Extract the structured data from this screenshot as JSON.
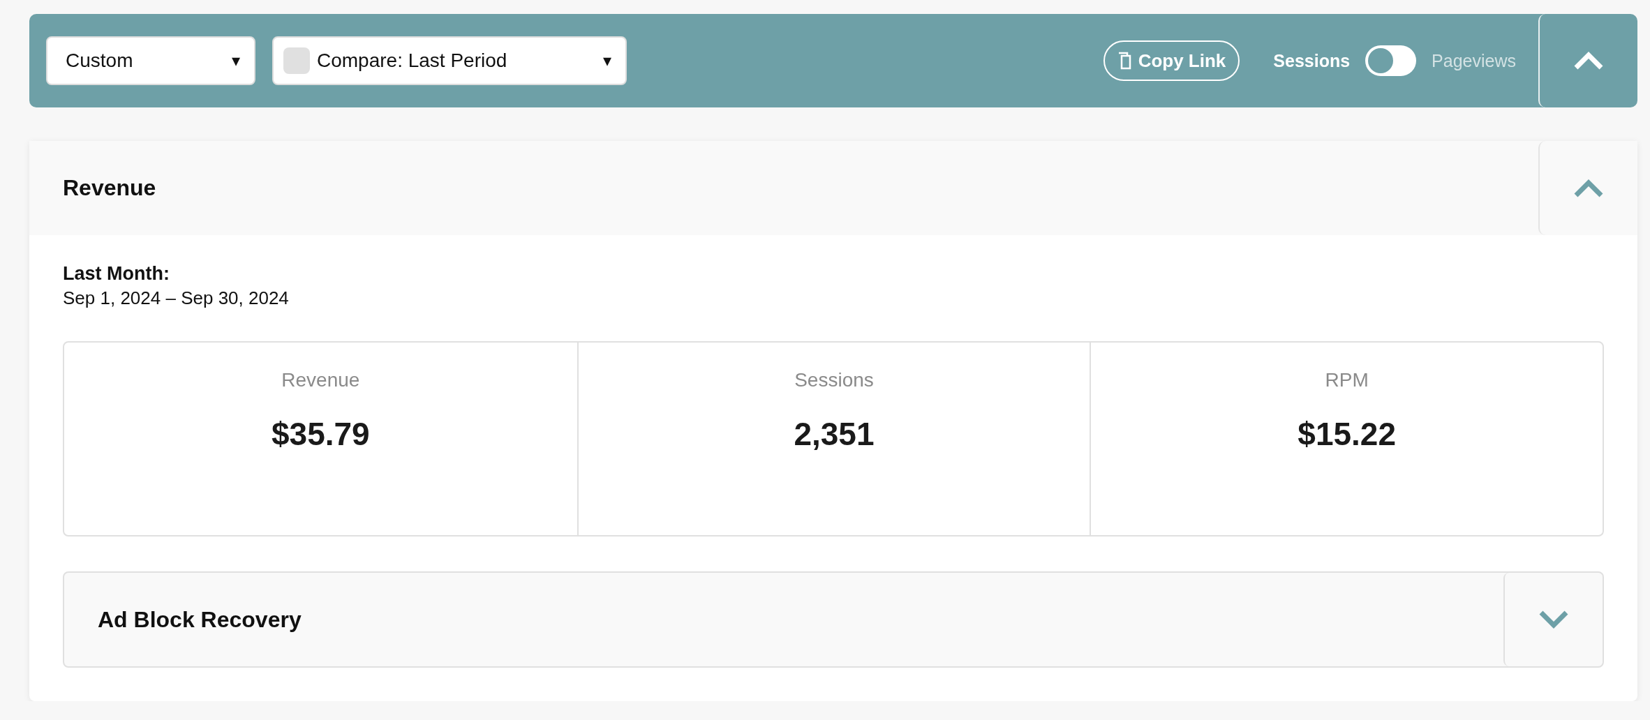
{
  "toolbar": {
    "expanded": true,
    "date_range": {
      "value": "Custom",
      "caret": "▾"
    },
    "compare": {
      "checked": false,
      "value": "Compare: Last Period",
      "caret": "▾"
    },
    "copy_link": {
      "label": "Copy Link"
    },
    "metric_toggle": {
      "options": [
        {
          "label": "Sessions",
          "selected": true
        },
        {
          "label": "Pageviews",
          "selected": false
        }
      ]
    }
  },
  "revenue_panel": {
    "title": "Revenue",
    "expanded": true,
    "period_label": "Last Month:",
    "period_dates": "Sep 1, 2024 – Sep 30, 2024",
    "stats": [
      {
        "label": "Revenue",
        "value": "$35.79"
      },
      {
        "label": "Sessions",
        "value": "2,351"
      },
      {
        "label": "RPM",
        "value": "$15.22"
      }
    ],
    "subpanels": [
      {
        "title": "Ad Block Recovery",
        "expanded": false
      }
    ]
  }
}
